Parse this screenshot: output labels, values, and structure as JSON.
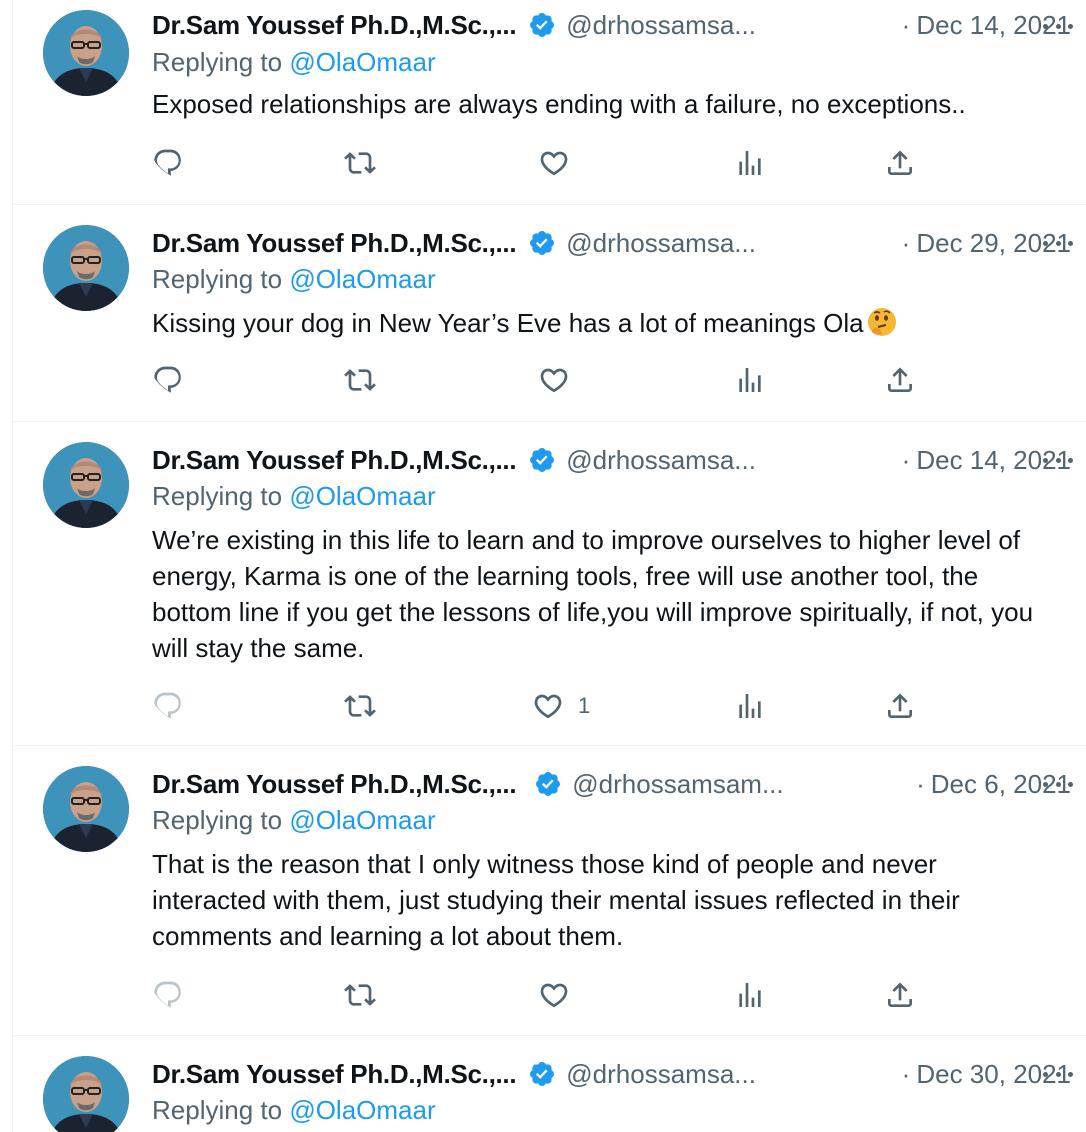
{
  "colors": {
    "accent": "#1d9bf0",
    "secondary_text": "#536471",
    "primary_text": "#0f1419",
    "divider": "#eff3f4"
  },
  "tweets": [
    {
      "name": "Dr.Sam Youssef Ph.D.,M.Sc.,...",
      "handle": "@drhossamsa...",
      "dot": "·",
      "date": "Dec 14, 2021",
      "replying_prefix": "Replying to",
      "replying_to": "@OlaOmaar",
      "text": "Exposed relationships are always ending with a failure, no exceptions..",
      "like_count": ""
    },
    {
      "name": "Dr.Sam Youssef Ph.D.,M.Sc.,...",
      "handle": "@drhossamsa...",
      "dot": "·",
      "date": "Dec 29, 2021",
      "replying_prefix": "Replying to",
      "replying_to": "@OlaOmaar",
      "text": "Kissing your dog in New Year’s Eve has a lot of meanings Ola",
      "emoji": "thinking-face-emoji",
      "like_count": ""
    },
    {
      "name": "Dr.Sam Youssef Ph.D.,M.Sc.,...",
      "handle": "@drhossamsa...",
      "dot": "·",
      "date": "Dec 14, 2021",
      "replying_prefix": "Replying to",
      "replying_to": "@OlaOmaar",
      "text": "We’re existing in this life to learn and to improve ourselves to higher level of energy, Karma is one of the learning tools, free will use another tool, the bottom line if you get the lessons of life,you will improve spiritually, if not, you will stay the same.",
      "like_count": "1"
    },
    {
      "name": "Dr.Sam Youssef Ph.D.,M.Sc.,...",
      "handle": "@drhossamsam...",
      "dot": "·",
      "date": "Dec 6, 2021",
      "replying_prefix": "Replying to",
      "replying_to": "@OlaOmaar",
      "text": "That is the reason that I only witness those kind of people and never interacted with them, just studying their mental issues reflected in their comments and learning a lot about them.",
      "like_count": ""
    },
    {
      "name": "Dr.Sam Youssef Ph.D.,M.Sc.,...",
      "handle": "@drhossamsa...",
      "dot": "·",
      "date": "Dec 30, 2021",
      "replying_prefix": "Replying to",
      "replying_to": "@OlaOmaar"
    }
  ],
  "icons": {
    "reply": "reply-icon",
    "retweet": "retweet-icon",
    "like": "heart-icon",
    "views": "views-icon",
    "share": "share-icon",
    "verified": "verified-badge-icon",
    "more": "more-options-icon"
  }
}
